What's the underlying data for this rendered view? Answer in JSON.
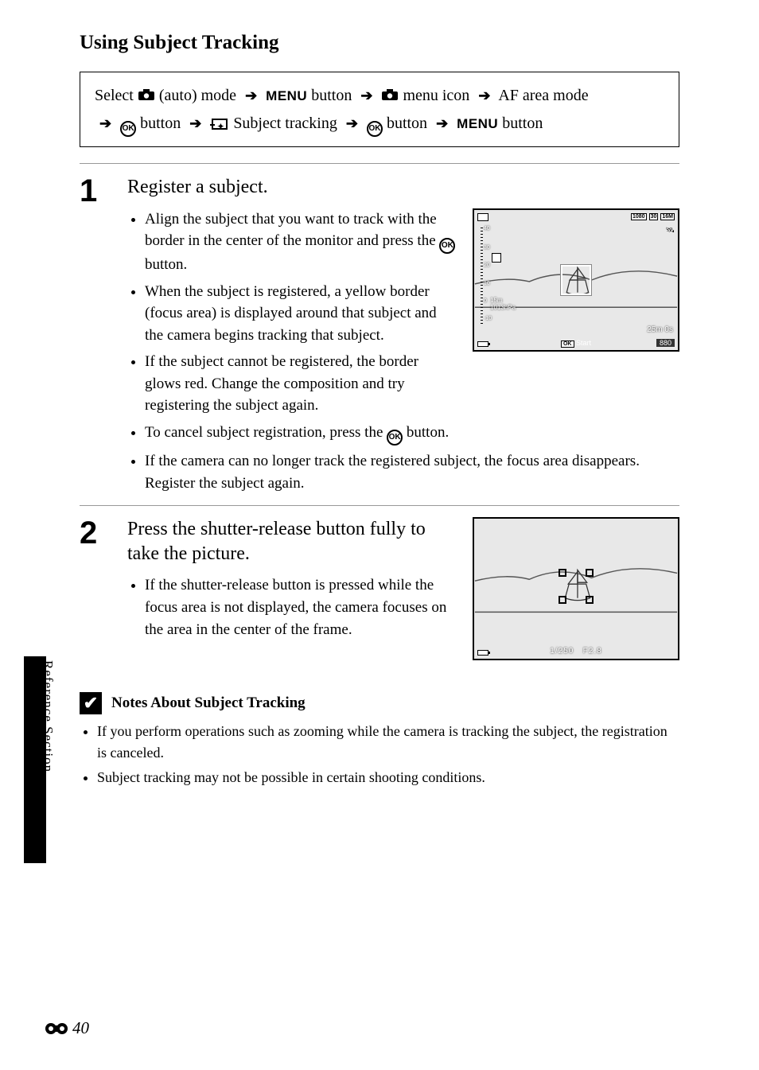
{
  "page": {
    "title": "Using Subject Tracking",
    "side_tab": "Reference Section",
    "page_number": "40"
  },
  "nav": {
    "p1": "Select",
    "p2": "(auto) mode",
    "p3": "button",
    "p4": "menu icon",
    "p5": "AF area mode",
    "p6": "button",
    "p7": "Subject tracking",
    "p8": "button",
    "p9": "button",
    "menu_label": "MENU",
    "ok_label": "OK"
  },
  "step1": {
    "num": "1",
    "title": "Register a subject.",
    "b1a": "Align the subject that you want to track with the border in the center of the monitor and press the ",
    "b1b": " button.",
    "b2": "When the subject is registered, a yellow border (focus area) is displayed around that subject and the camera begins tracking that subject.",
    "b3": "If the subject cannot be registered, the border glows red. Change the composition and try registering the subject again.",
    "b4a": "To cancel subject registration, press the ",
    "b4b": " button.",
    "b5": "If the camera can no longer track the registered subject, the focus area disappears. Register the subject again."
  },
  "monitor1": {
    "top_badges": [
      "1080",
      "30",
      "16M"
    ],
    "gauge_ticks": [
      "40",
      "30",
      "20",
      "10",
      "0",
      "-10"
    ],
    "altitude": "15m",
    "pressure": "1013hPa",
    "time_remaining": "25m 0s",
    "shots": "880",
    "start_label": "Start",
    "ok": "OK"
  },
  "step2": {
    "num": "2",
    "title": "Press the shutter-release button fully to take the picture.",
    "b1": "If the shutter-release button is pressed while the focus area is not displayed, the camera focuses on the area in the center of the frame."
  },
  "monitor2": {
    "shutter": "1/250",
    "aperture": "F2.8"
  },
  "notes": {
    "heading": "Notes About Subject Tracking",
    "n1": "If you perform operations such as zooming while the camera is tracking the subject, the registration is canceled.",
    "n2": "Subject tracking may not be possible in certain shooting conditions."
  }
}
